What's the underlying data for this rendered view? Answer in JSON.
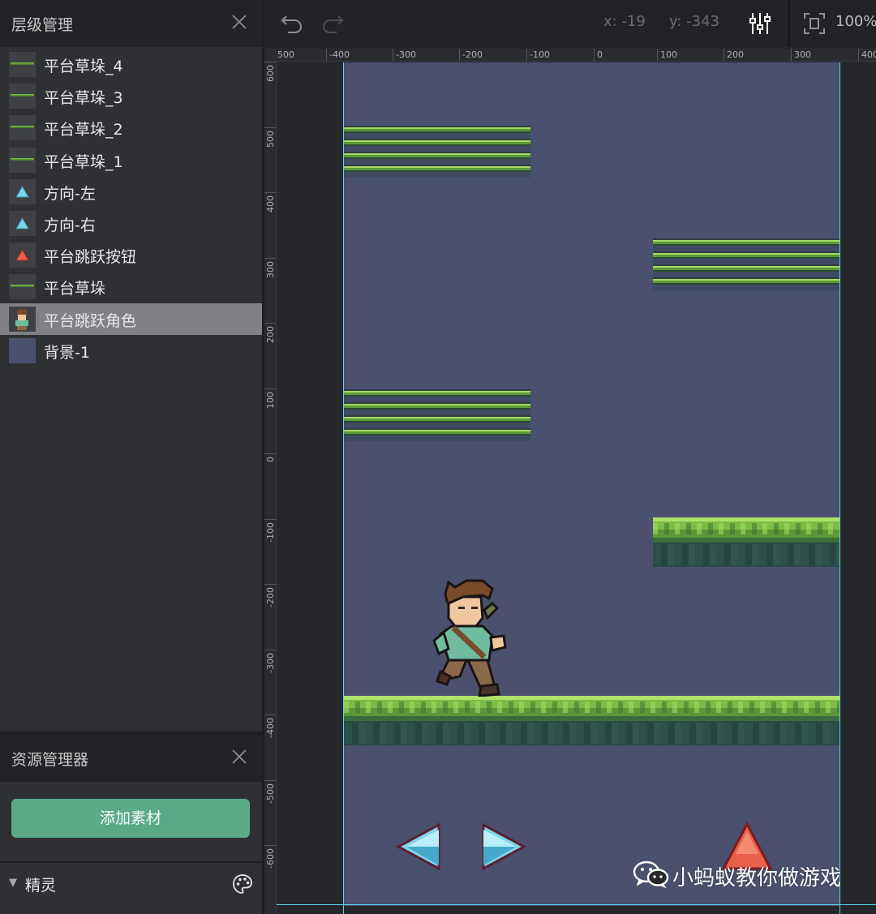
{
  "layers_panel": {
    "title": "层级管理",
    "items": [
      {
        "label": "平台草垛_4",
        "thumb": "grass"
      },
      {
        "label": "平台草垛_3",
        "thumb": "grass"
      },
      {
        "label": "平台草垛_2",
        "thumb": "grass"
      },
      {
        "label": "平台草垛_1",
        "thumb": "grass"
      },
      {
        "label": "方向-左",
        "thumb": "blue-triangle"
      },
      {
        "label": "方向-右",
        "thumb": "blue-triangle"
      },
      {
        "label": "平台跳跃按钮",
        "thumb": "red-triangle"
      },
      {
        "label": "平台草垛",
        "thumb": "grass"
      },
      {
        "label": "平台跳跃角色",
        "thumb": "character",
        "selected": true
      },
      {
        "label": "背景-1",
        "thumb": "background"
      }
    ]
  },
  "assets_panel": {
    "title": "资源管理器",
    "add_button": "添加素材",
    "section_label": "精灵"
  },
  "toolbar": {
    "undo_icon": "undo-icon",
    "redo_icon": "redo-icon",
    "cursor_x": "x: -19",
    "cursor_y": "y: -343",
    "settings_icon": "sliders-icon",
    "fit_icon": "fit-frame-icon",
    "zoom": "100%"
  },
  "rulers": {
    "top": [
      "500",
      "-400",
      "-300",
      "-200",
      "-100",
      "0",
      "100",
      "200",
      "300",
      "400"
    ],
    "left": [
      "600",
      "500",
      "400",
      "300",
      "200",
      "100",
      "0",
      "-100",
      "-200",
      "-300",
      "-400",
      "-500",
      "-600"
    ]
  },
  "watermark": "小蚂蚁教你做游戏",
  "colors": {
    "stage_bg": "#4b506e",
    "accent_green": "#5aaa88",
    "guide_cyan": "#55d6e3",
    "selection": "#808185"
  }
}
